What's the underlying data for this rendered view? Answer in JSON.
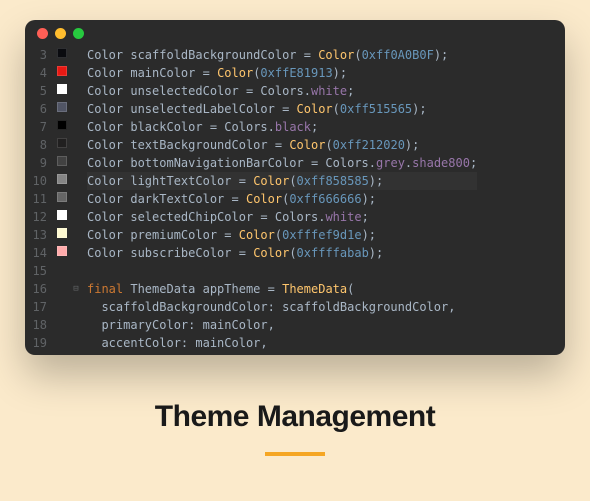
{
  "title": "Theme Management",
  "lines": [
    {
      "num": 3,
      "swatch": "#0A0B0F",
      "tokens": [
        {
          "t": "Color ",
          "c": "cls"
        },
        {
          "t": "scaffoldBackgroundColor ",
          "c": "ident"
        },
        {
          "t": "= ",
          "c": "op"
        },
        {
          "t": "Color",
          "c": "fn"
        },
        {
          "t": "(",
          "c": "op"
        },
        {
          "t": "0xff0A0B0F",
          "c": "num"
        },
        {
          "t": ");",
          "c": "op"
        }
      ]
    },
    {
      "num": 4,
      "swatch": "#E81913",
      "tokens": [
        {
          "t": "Color ",
          "c": "cls"
        },
        {
          "t": "mainColor ",
          "c": "ident"
        },
        {
          "t": "= ",
          "c": "op"
        },
        {
          "t": "Color",
          "c": "fn"
        },
        {
          "t": "(",
          "c": "op"
        },
        {
          "t": "0xffE81913",
          "c": "num"
        },
        {
          "t": ");",
          "c": "op"
        }
      ]
    },
    {
      "num": 5,
      "swatch": "#ffffff",
      "tokens": [
        {
          "t": "Color ",
          "c": "cls"
        },
        {
          "t": "unselectedColor ",
          "c": "ident"
        },
        {
          "t": "= Colors.",
          "c": "op"
        },
        {
          "t": "white",
          "c": "prop"
        },
        {
          "t": ";",
          "c": "op"
        }
      ]
    },
    {
      "num": 6,
      "swatch": "#515565",
      "tokens": [
        {
          "t": "Color ",
          "c": "cls"
        },
        {
          "t": "unselectedLabelColor ",
          "c": "ident"
        },
        {
          "t": "= ",
          "c": "op"
        },
        {
          "t": "Color",
          "c": "fn"
        },
        {
          "t": "(",
          "c": "op"
        },
        {
          "t": "0xff515565",
          "c": "num"
        },
        {
          "t": ");",
          "c": "op"
        }
      ]
    },
    {
      "num": 7,
      "swatch": "#000000",
      "tokens": [
        {
          "t": "Color ",
          "c": "cls"
        },
        {
          "t": "blackColor ",
          "c": "ident"
        },
        {
          "t": "= Colors.",
          "c": "op"
        },
        {
          "t": "black",
          "c": "prop"
        },
        {
          "t": ";",
          "c": "op"
        }
      ]
    },
    {
      "num": 8,
      "swatch": "#212020",
      "tokens": [
        {
          "t": "Color ",
          "c": "cls"
        },
        {
          "t": "textBackgroundColor ",
          "c": "ident"
        },
        {
          "t": "= ",
          "c": "op"
        },
        {
          "t": "Color",
          "c": "fn"
        },
        {
          "t": "(",
          "c": "op"
        },
        {
          "t": "0xff212020",
          "c": "num"
        },
        {
          "t": ");",
          "c": "op"
        }
      ]
    },
    {
      "num": 9,
      "swatch": "#424242",
      "tokens": [
        {
          "t": "Color ",
          "c": "cls"
        },
        {
          "t": "bottomNavigationBarColor ",
          "c": "ident"
        },
        {
          "t": "= Colors.",
          "c": "op"
        },
        {
          "t": "grey",
          "c": "prop"
        },
        {
          "t": ".",
          "c": "op"
        },
        {
          "t": "shade800",
          "c": "prop"
        },
        {
          "t": ";",
          "c": "op"
        }
      ]
    },
    {
      "num": 10,
      "swatch": "#858585",
      "hl": true,
      "tokens": [
        {
          "t": "Color ",
          "c": "cls"
        },
        {
          "t": "lightTextColor ",
          "c": "ident"
        },
        {
          "t": "= ",
          "c": "op"
        },
        {
          "t": "Color",
          "c": "fn"
        },
        {
          "t": "(",
          "c": "op"
        },
        {
          "t": "0xff858585",
          "c": "num"
        },
        {
          "t": ");",
          "c": "op"
        }
      ]
    },
    {
      "num": 11,
      "swatch": "#666666",
      "tokens": [
        {
          "t": "Color ",
          "c": "cls"
        },
        {
          "t": "darkTextColor ",
          "c": "ident"
        },
        {
          "t": "= ",
          "c": "op"
        },
        {
          "t": "Color",
          "c": "fn"
        },
        {
          "t": "(",
          "c": "op"
        },
        {
          "t": "0xff666666",
          "c": "num"
        },
        {
          "t": ");",
          "c": "op"
        }
      ]
    },
    {
      "num": 12,
      "swatch": "#ffffff",
      "tokens": [
        {
          "t": "Color ",
          "c": "cls"
        },
        {
          "t": "selectedChipColor ",
          "c": "ident"
        },
        {
          "t": "= Colors.",
          "c": "op"
        },
        {
          "t": "white",
          "c": "prop"
        },
        {
          "t": ";",
          "c": "op"
        }
      ]
    },
    {
      "num": 13,
      "swatch": "#fef9d1",
      "tokens": [
        {
          "t": "Color ",
          "c": "cls"
        },
        {
          "t": "premiumColor ",
          "c": "ident"
        },
        {
          "t": "= ",
          "c": "op"
        },
        {
          "t": "Color",
          "c": "fn"
        },
        {
          "t": "(",
          "c": "op"
        },
        {
          "t": "0xfffef9d1e",
          "c": "num"
        },
        {
          "t": ");",
          "c": "op"
        }
      ]
    },
    {
      "num": 14,
      "swatch": "#ffabab",
      "tokens": [
        {
          "t": "Color ",
          "c": "cls"
        },
        {
          "t": "subscribeColor ",
          "c": "ident"
        },
        {
          "t": "= ",
          "c": "op"
        },
        {
          "t": "Color",
          "c": "fn"
        },
        {
          "t": "(",
          "c": "op"
        },
        {
          "t": "0xffffabab",
          "c": "num"
        },
        {
          "t": ");",
          "c": "op"
        }
      ]
    },
    {
      "num": 15,
      "swatch": null,
      "tokens": [
        {
          "t": "",
          "c": "op"
        }
      ]
    },
    {
      "num": 16,
      "swatch": null,
      "fold": true,
      "tokens": [
        {
          "t": "final ",
          "c": "kw"
        },
        {
          "t": "ThemeData ",
          "c": "cls"
        },
        {
          "t": "appTheme ",
          "c": "ident"
        },
        {
          "t": "= ",
          "c": "op"
        },
        {
          "t": "ThemeData",
          "c": "fn"
        },
        {
          "t": "(",
          "c": "op"
        }
      ]
    },
    {
      "num": 17,
      "swatch": null,
      "tokens": [
        {
          "t": "  scaffoldBackgroundColor: scaffoldBackgroundColor,",
          "c": "ident"
        }
      ]
    },
    {
      "num": 18,
      "swatch": null,
      "tokens": [
        {
          "t": "  primaryColor: mainColor,",
          "c": "ident"
        }
      ]
    },
    {
      "num": 19,
      "swatch": null,
      "tokens": [
        {
          "t": "  accentColor: mainColor,",
          "c": "ident"
        }
      ]
    }
  ]
}
